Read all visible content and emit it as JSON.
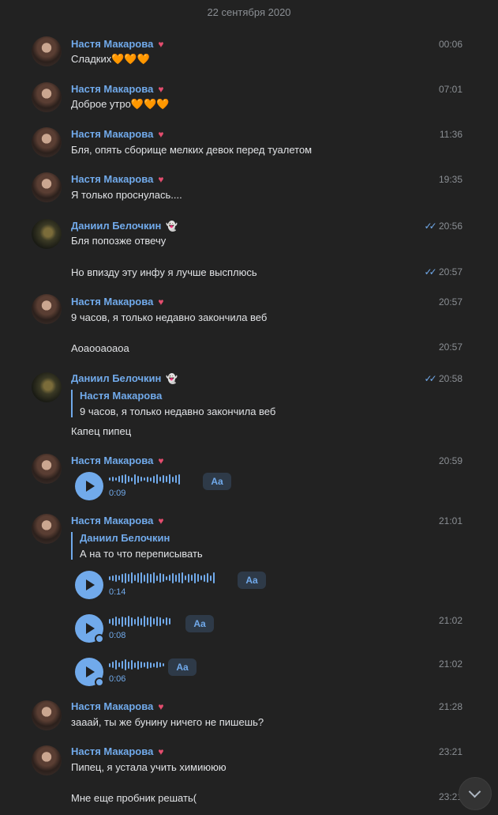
{
  "date_separator": "22 сентября 2020",
  "nastya": "Настя Макарова",
  "daniil": "Даниил Белочкин",
  "msgs": {
    "m1": {
      "text": "Сладких",
      "hearts": "🧡🧡🧡",
      "time": "00:06"
    },
    "m2": {
      "text": "Доброе утро",
      "hearts": "🧡🧡🧡",
      "time": "07:01"
    },
    "m3": {
      "text": "Бля, опять сборище мелких девок перед туалетом",
      "time": "11:36"
    },
    "m4": {
      "text": "Я только проснулась....",
      "time": "19:35"
    },
    "m5": {
      "text": "Бля попозже отвечу",
      "time": "20:56"
    },
    "m6": {
      "text": "Но впизду эту инфу я лучше высплюсь",
      "time": "20:57"
    },
    "m7": {
      "text": "9 часов, я только недавно закончила веб",
      "time": "20:57"
    },
    "m8": {
      "text": "Аоаооаоаоа",
      "time": "20:57"
    },
    "m9": {
      "quote_name": "Настя Макарова",
      "quote_text": "9 часов, я только недавно закончила веб",
      "text": "Капец пипец",
      "time": "20:58"
    },
    "m10": {
      "duration": "0:09",
      "time": "20:59"
    },
    "m11": {
      "quote_name": "Даниил Белочкин",
      "quote_text": "А на то что переписывать",
      "duration": "0:14",
      "time": "21:01"
    },
    "m12": {
      "duration": "0:08",
      "time": "21:02"
    },
    "m13": {
      "duration": "0:06",
      "time": "21:02"
    },
    "m14": {
      "text": "зааай, ты же бунину ничего не пишешь?",
      "time": "21:28"
    },
    "m15": {
      "text": "Пипец, я устала учить химиююю",
      "time": "23:21"
    },
    "m16": {
      "text": "Мне еще пробник решать(",
      "time": "23:21"
    }
  },
  "transcribe_label": "Aa",
  "colors": {
    "background": "#222222",
    "accent": "#71aaeb",
    "text": "#e1e3e6",
    "muted": "#8b8f94"
  },
  "icons": {
    "nastya_badge": "heart-emoji-icon",
    "daniil_badge": "ghost-emoji-icon",
    "play": "play-icon",
    "scroll_down": "chevron-down-icon",
    "read": "double-check-icon"
  }
}
